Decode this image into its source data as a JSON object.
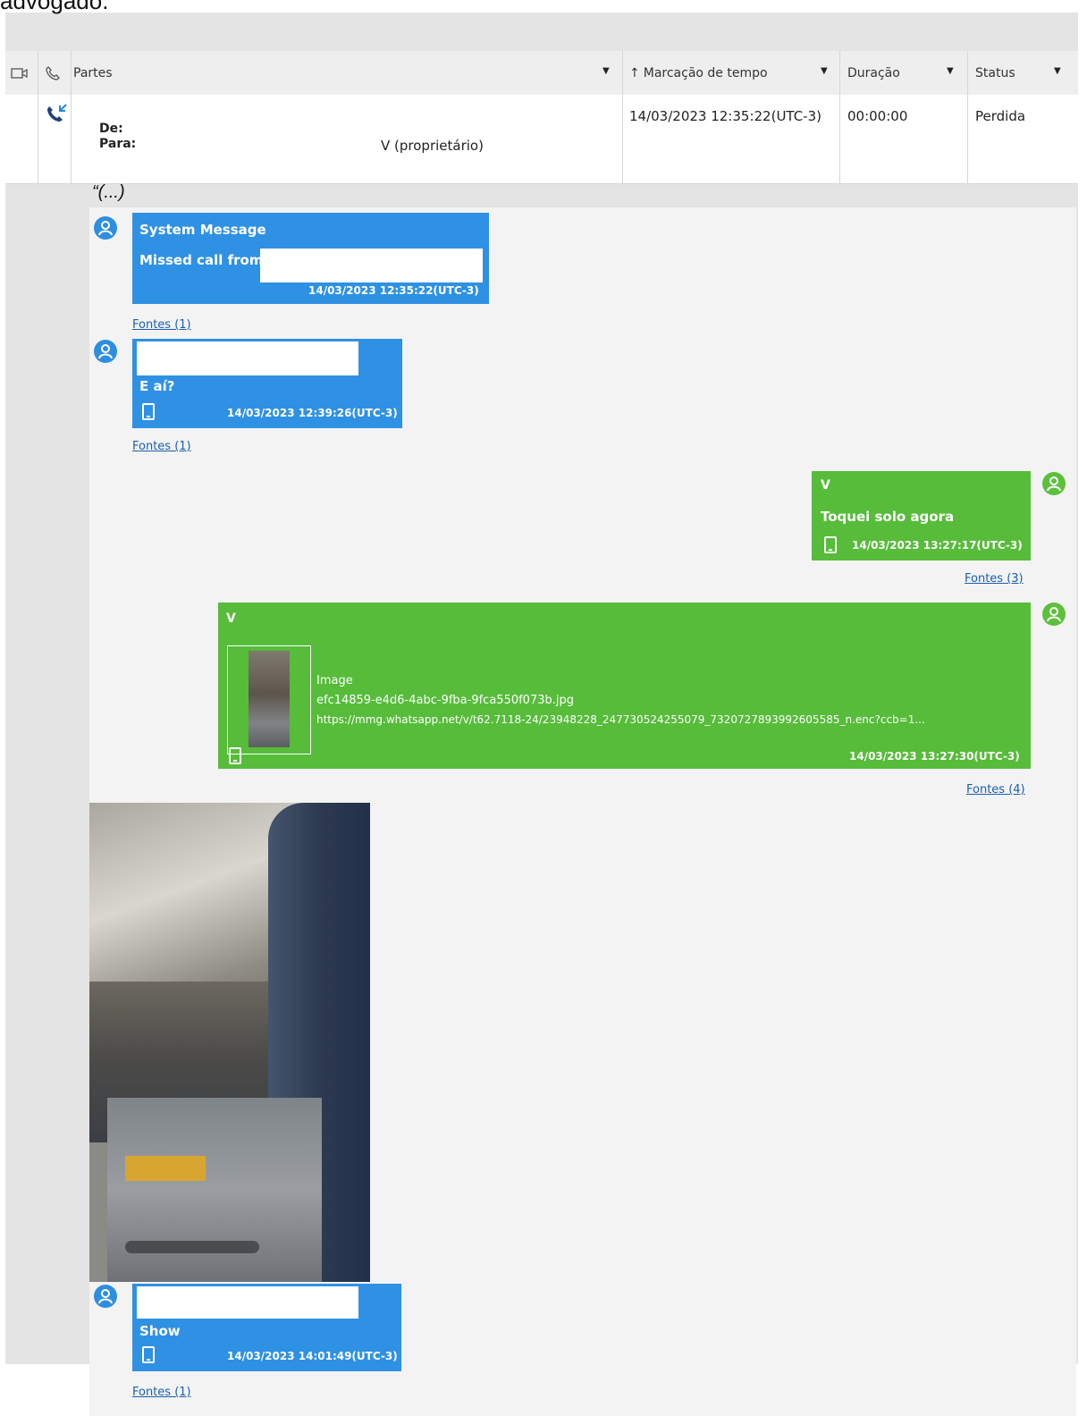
{
  "intro_text": "advogado.",
  "table": {
    "columns": [
      "Partes",
      "Marcação de tempo",
      "Duração",
      "Status"
    ],
    "row": {
      "de_label": "De:",
      "para_label": "Para:",
      "para_value": "V (proprietário)",
      "timestamp": "14/03/2023 12:35:22(UTC-3)",
      "duration": "00:00:00",
      "status": "Perdida"
    }
  },
  "quote_open": "“(...)",
  "messages": [
    {
      "title": "System Message",
      "text": "Missed call from",
      "time": "14/03/2023 12:35:22(UTC-3)",
      "sources": "Fontes (1)"
    },
    {
      "text": "E aí?",
      "time": "14/03/2023 12:39:26(UTC-3)",
      "sources": "Fontes (1)"
    },
    {
      "sender": "V",
      "text": "Toquei solo agora",
      "time": "14/03/2023 13:27:17(UTC-3)",
      "sources": "Fontes (3)"
    },
    {
      "sender": "V",
      "attachment_type": "Image",
      "filename": "efc14859-e4d6-4abc-9fba-9fca550f073b.jpg",
      "url": "https://mmg.whatsapp.net/v/t62.7118-24/23948228_247730524255079_7320727893992605585_n.enc?ccb=1...",
      "time": "14/03/2023 13:27:30(UTC-3)",
      "sources": "Fontes (4)"
    },
    {
      "text": "Show",
      "time": "14/03/2023 14:01:49(UTC-3)",
      "sources": "Fontes (1)"
    }
  ],
  "colors": {
    "blue_bubble": "#2f91e3",
    "green_bubble": "#56bc3a",
    "link": "#1a5fb0"
  }
}
